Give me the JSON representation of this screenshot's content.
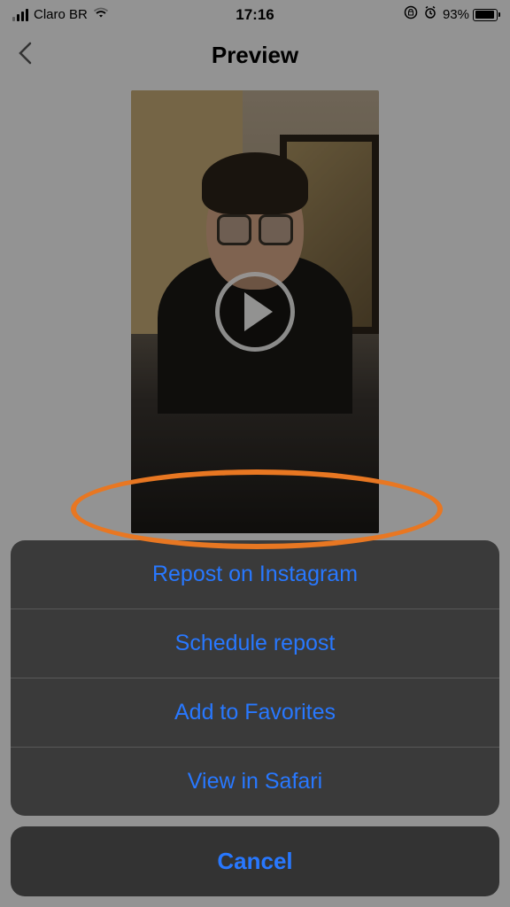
{
  "statusBar": {
    "carrier": "Claro BR",
    "time": "17:16",
    "batteryPercent": "93%"
  },
  "header": {
    "title": "Preview"
  },
  "actionSheet": {
    "items": [
      "Repost on Instagram",
      "Schedule repost",
      "Add to Favorites",
      "View in Safari"
    ],
    "cancel": "Cancel"
  },
  "annotation": {
    "highlightColor": "#e87722",
    "highlightedItem": 0
  }
}
